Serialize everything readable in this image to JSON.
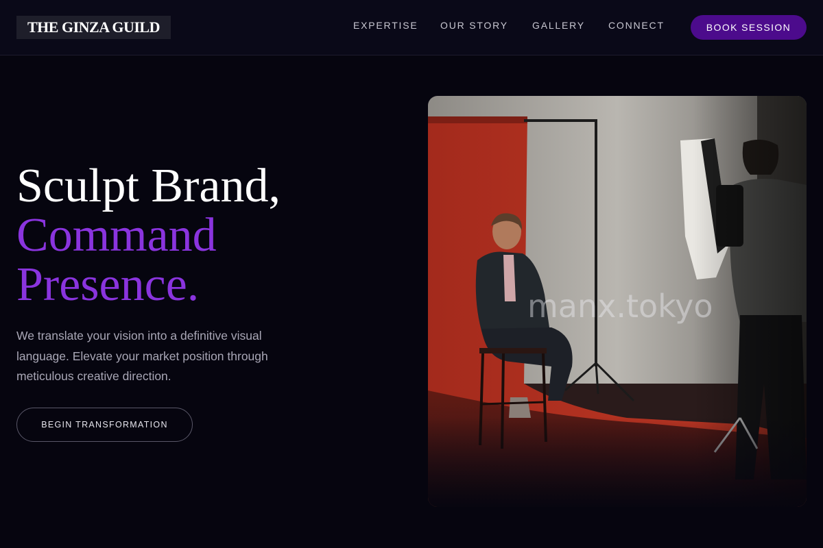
{
  "header": {
    "logo_text": "THE GINZA GUILD",
    "nav": [
      "EXPERTISE",
      "OUR STORY",
      "GALLERY",
      "CONNECT"
    ],
    "cta_label": "BOOK SESSION"
  },
  "hero": {
    "headline_lines": [
      "Sculpt Brand,",
      "Command",
      "Presence."
    ],
    "subcopy": "We translate your vision into a definitive visual language. Elevate your market position through meticulous creative direction.",
    "cta_label": "BEGIN TRANSFORMATION"
  },
  "photo": {
    "watermark": "manx.tokyo"
  },
  "colors": {
    "background": "#06050f",
    "header_background": "#0a0918",
    "accent_purple": "#8a34de",
    "button_purple": "#4c0b8c",
    "backdrop_red": "#b83422"
  }
}
